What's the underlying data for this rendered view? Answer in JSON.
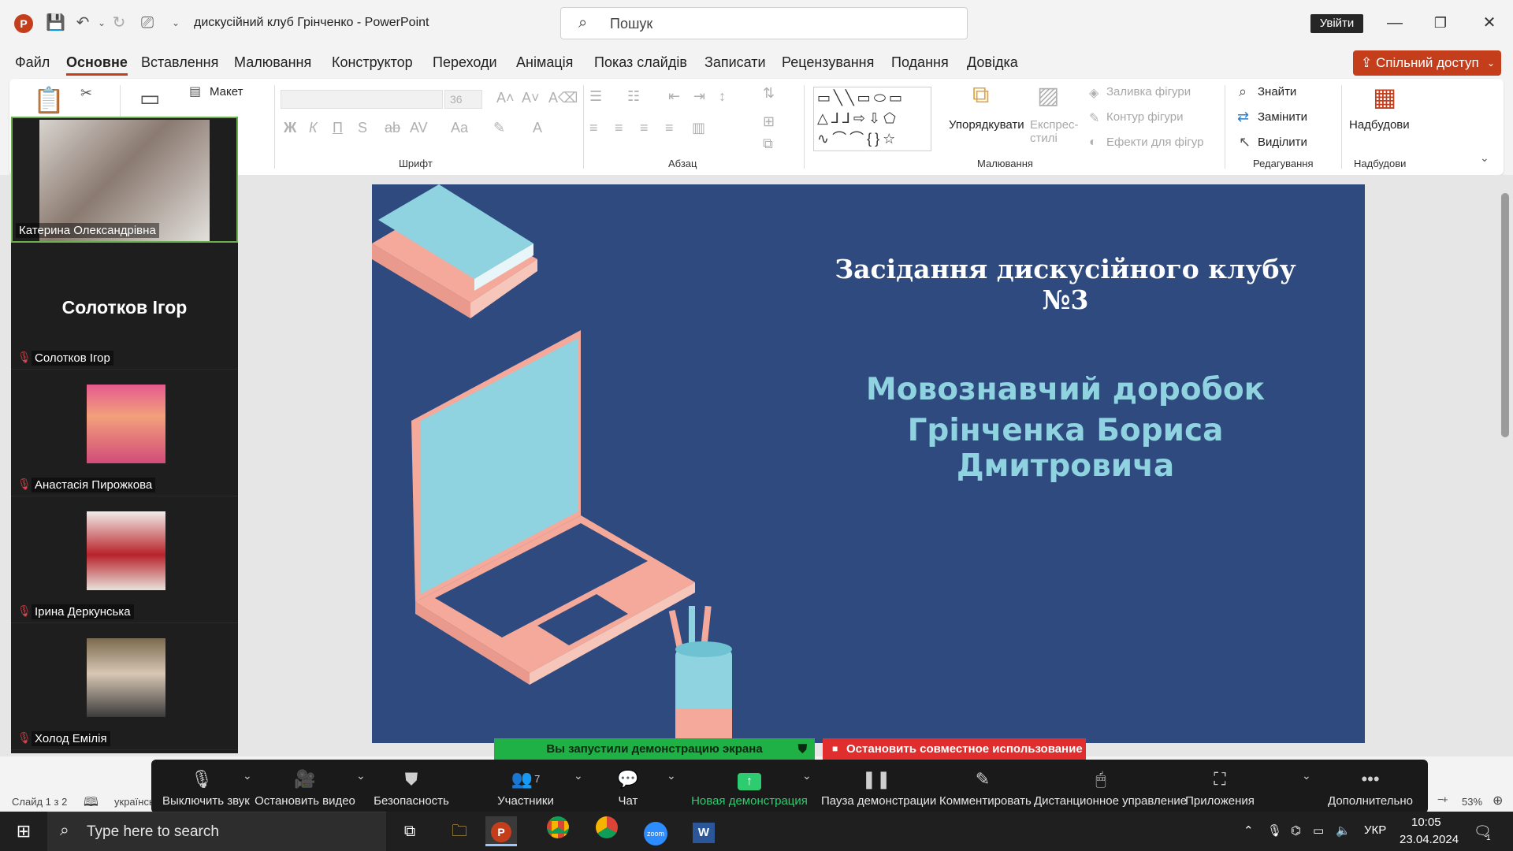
{
  "window": {
    "doc_title": "дискусійний клуб Грінченко  -  PowerPoint",
    "search_placeholder": "Пошук",
    "signin_label": "Увійти"
  },
  "menu": {
    "items": [
      "Файл",
      "Основне",
      "Вставлення",
      "Малювання",
      "Конструктор",
      "Переходи",
      "Анімація",
      "Показ слайдів",
      "Записати",
      "Рецензування",
      "Подання",
      "Довідка"
    ],
    "share_label": "Спільний доступ"
  },
  "ribbon": {
    "layout_label": "Макет",
    "font_size": "36",
    "groups": {
      "font": "Шрифт",
      "paragraph": "Абзац",
      "drawing": "Малювання",
      "editing": "Редагування",
      "addins": "Надбудови"
    },
    "arrange_label": "Упорядкувати",
    "express_styles_label": "Експрес-стилі",
    "shape_fill_label": "Заливка фігури",
    "shape_outline_label": "Контур фігури",
    "shape_effects_label": "Ефекти для фігур",
    "find_label": "Знайти",
    "replace_label": "Замінити",
    "select_label": "Виділити",
    "addins_label": "Надбудови"
  },
  "slide": {
    "title": "Засідання дискусійного клубу №3",
    "subtitle_line1": "Мовознавчий доробок",
    "subtitle_line2": "Грінченка Бориса Дмитровича"
  },
  "participants": {
    "speaker": "Катерина Олександрівна",
    "no_video_big": "Солотков Ігор",
    "list": [
      "Солотков Ігор",
      "Анастасія Пирожкова",
      "Ірина Деркунська",
      "Холод Емілія"
    ]
  },
  "share_banner": {
    "started": "Вы запустили демонстрацию экрана",
    "stop": "Остановить совместное использование"
  },
  "zoom_toolbar": {
    "mute": "Выключить звук",
    "stop_video": "Остановить видео",
    "security": "Безопасность",
    "participants": "Участники",
    "participants_count": "7",
    "chat": "Чат",
    "new_share": "Новая демонстрация",
    "pause_share": "Пауза демонстрации",
    "annotate": "Комментировать",
    "remote_control": "Дистанционное управление",
    "apps": "Приложения",
    "more": "Дополнительно"
  },
  "statusbar": {
    "slide_info": "Слайд 1 з 2",
    "language": "українськ",
    "zoom": "53%"
  },
  "taskbar": {
    "search_placeholder": "Type here to search",
    "lang": "УКР",
    "time": "10:05",
    "date": "23.04.2024",
    "notification_count": "1"
  }
}
